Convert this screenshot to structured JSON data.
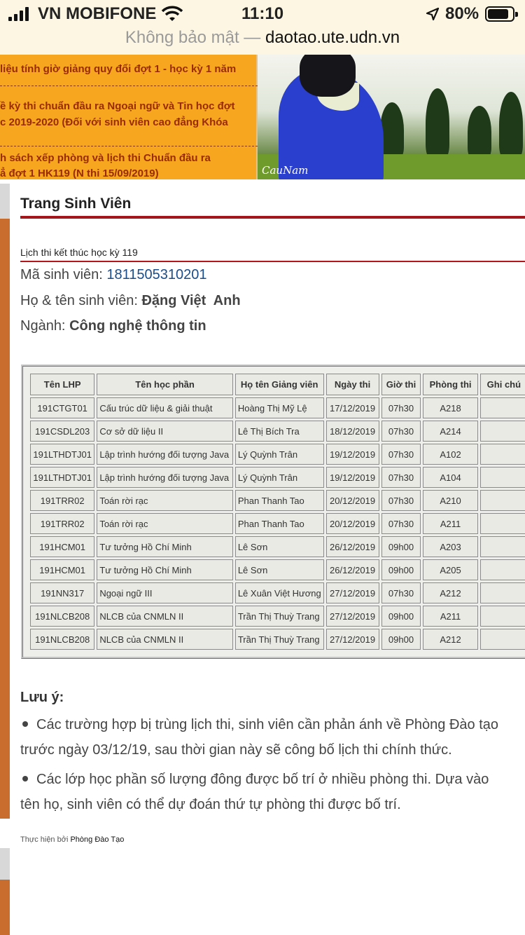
{
  "status_bar": {
    "carrier": "VN MOBIFONE",
    "time": "11:10",
    "battery": "80%",
    "battery_level": 0.8
  },
  "url_bar": {
    "security": "Không bảo mật —",
    "host": "daotao.ute.udn.vn"
  },
  "banner": {
    "news": [
      "liệu tính giờ giảng quy đổi đợt 1 - học kỳ 1 năm",
      "ề kỳ thi chuẩn đầu ra Ngoại ngữ và Tin học đợt",
      "c 2019-2020 (Đối với sinh viên cao đẳng Khóa",
      "h sách xếp phòng và lịch thi Chuẩn đầu ra",
      "ẳ   đợt 1 HK119 (N   thi 15/09/2019)"
    ],
    "photo_signature": "CauNam"
  },
  "page": {
    "title": "Trang Sinh Viên",
    "section_title": "Lịch thi kết thúc học kỳ 119",
    "student_id_label": "Mã sinh viên:",
    "student_id": "1811505310201",
    "name_label": "Họ & tên sinh viên:",
    "name": "Đặng Việt  Anh",
    "major_label": "Ngành:",
    "major": "Công nghệ thông tin"
  },
  "table": {
    "headers": [
      "Tên LHP",
      "Tên học phần",
      "Họ tên Giảng viên",
      "Ngày thi",
      "Giờ thi",
      "Phòng thi",
      "Ghi chú"
    ],
    "rows": [
      [
        "191CTGT01",
        "Cấu trúc dữ liệu & giải thuật",
        "Hoàng Thị Mỹ Lệ",
        "17/12/2019",
        "07h30",
        "A218",
        ""
      ],
      [
        "191CSDL203",
        "Cơ sở dữ liệu II",
        "Lê Thị Bích Tra",
        "18/12/2019",
        "07h30",
        "A214",
        ""
      ],
      [
        "191LTHDTJ01",
        "Lập trình hướng đối tượng Java",
        "Lý Quỳnh Trân",
        "19/12/2019",
        "07h30",
        "A102",
        ""
      ],
      [
        "191LTHDTJ01",
        "Lập trình hướng đối tượng Java",
        "Lý Quỳnh Trân",
        "19/12/2019",
        "07h30",
        "A104",
        ""
      ],
      [
        "191TRR02",
        "Toán rời rạc",
        "Phan Thanh Tao",
        "20/12/2019",
        "07h30",
        "A210",
        ""
      ],
      [
        "191TRR02",
        "Toán rời rạc",
        "Phan Thanh Tao",
        "20/12/2019",
        "07h30",
        "A211",
        ""
      ],
      [
        "191HCM01",
        "Tư tưởng Hồ Chí Minh",
        "Lê Sơn",
        "26/12/2019",
        "09h00",
        "A203",
        ""
      ],
      [
        "191HCM01",
        "Tư tưởng Hồ Chí Minh",
        "Lê Sơn",
        "26/12/2019",
        "09h00",
        "A205",
        ""
      ],
      [
        "191NN317",
        "Ngoại ngữ III",
        "Lê Xuân Việt Hương",
        "27/12/2019",
        "07h30",
        "A212",
        ""
      ],
      [
        "191NLCB208",
        "NLCB của CNMLN II",
        "Trần Thị Thuỳ Trang",
        "27/12/2019",
        "09h00",
        "A211",
        ""
      ],
      [
        "191NLCB208",
        "NLCB của CNMLN II",
        "Trần Thị Thuỳ Trang",
        "27/12/2019",
        "09h00",
        "A212",
        ""
      ]
    ]
  },
  "notes": {
    "heading": "Lưu ý:",
    "items": [
      [
        "Các trường hợp bị trùng lịch thi, sinh viên cần phản ánh về Phòng Đào tạo",
        "trước ngày 03/12/19, sau thời gian này sẽ công bố lịch thi chính thức."
      ],
      [
        "Các lớp học phần số lượng đông được bố trí ở nhiều phòng thi. Dựa vào",
        "tên họ, sinh viên có thể dự đoán thứ tự phòng thi được bố trí."
      ]
    ]
  },
  "footer": {
    "prefix": "Thực hiện bởi",
    "org": "Phòng Đào Tạo"
  }
}
